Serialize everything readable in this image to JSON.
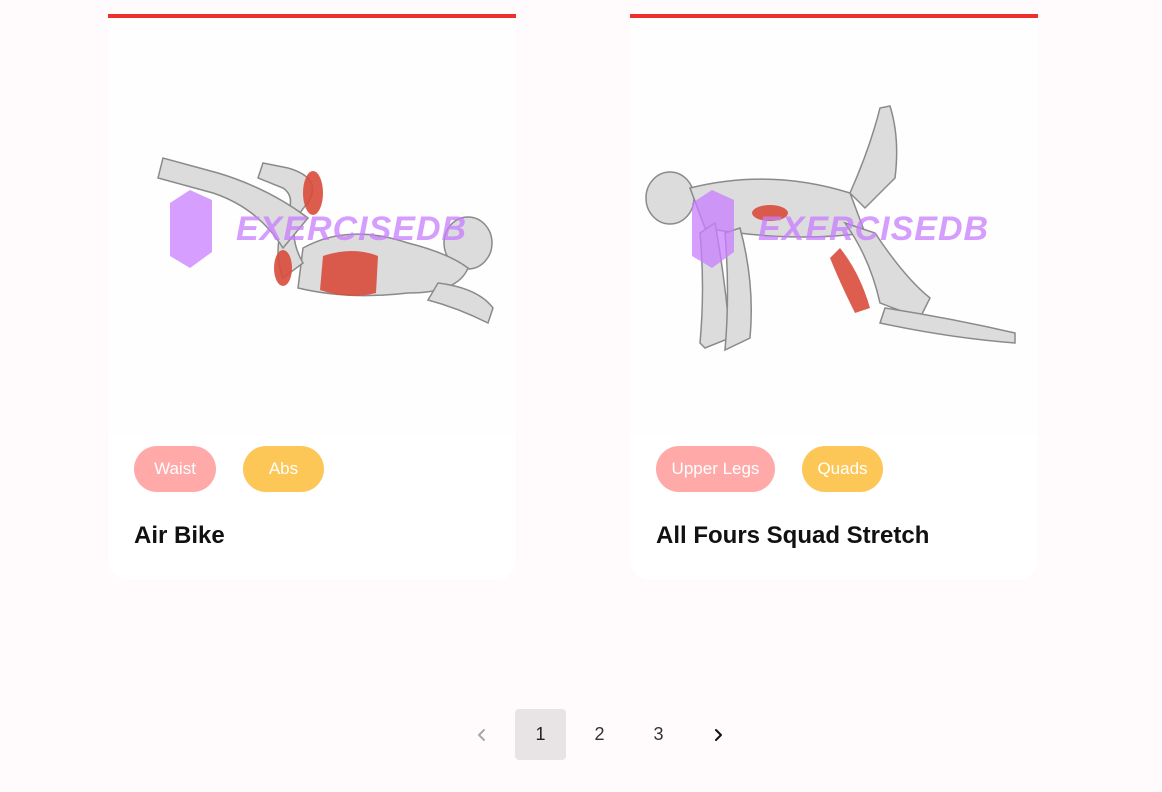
{
  "cards": [
    {
      "title": "Air Bike",
      "body_part": "Waist",
      "target": "Abs",
      "image_alt": "Air Bike exercise illustration",
      "watermark": "EXERCISEDB"
    },
    {
      "title": "All Fours Squad Stretch",
      "body_part": "Upper Legs",
      "target": "Quads",
      "image_alt": "All Fours Squad Stretch exercise illustration",
      "watermark": "EXERCISEDB"
    }
  ],
  "pagination": {
    "pages": [
      "1",
      "2",
      "3"
    ],
    "current_page": "1",
    "prev_icon": "chevron-left-icon",
    "next_icon": "chevron-right-icon"
  },
  "colors": {
    "accent": "#ef2e2e",
    "body_part_tag": "#ffa9a9",
    "target_tag": "#fcc757",
    "watermark": "#c77dff",
    "muscle_highlight": "#d94c3c"
  }
}
